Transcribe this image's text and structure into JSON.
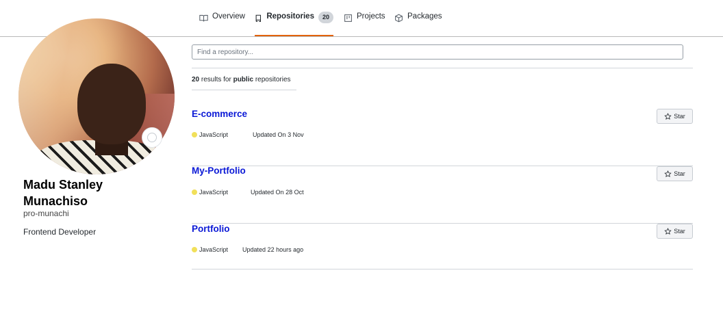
{
  "tabs": [
    {
      "label": "Overview",
      "icon": "book-icon"
    },
    {
      "label": "Repositories",
      "icon": "repo-icon",
      "count": "20",
      "active": true
    },
    {
      "label": "Projects",
      "icon": "project-board-icon"
    },
    {
      "label": "Packages",
      "icon": "package-icon"
    }
  ],
  "profile": {
    "name": "Madu Stanley Munachiso",
    "username": "pro-munachi",
    "bio": "Frontend Developer"
  },
  "search": {
    "placeholder": "Find a repository..."
  },
  "results": {
    "count": "20",
    "text_mid": " results for ",
    "visibility": "public",
    "text_end": " repositories"
  },
  "repos": [
    {
      "name": "E-commerce",
      "language": "JavaScript",
      "updated": "Updated On 3 Nov",
      "star_label": "Star"
    },
    {
      "name": "My-Portfolio",
      "language": "JavaScript",
      "updated": "Updated On 28 Oct",
      "star_label": "Star"
    },
    {
      "name": "Portfolio",
      "language": "JavaScript",
      "updated": "Updated 22 hours ago",
      "star_label": "Star"
    }
  ],
  "colors": {
    "accent_tab_underline": "#e36209",
    "repo_link": "#0a18d6",
    "javascript_dot": "#f1e05a"
  }
}
